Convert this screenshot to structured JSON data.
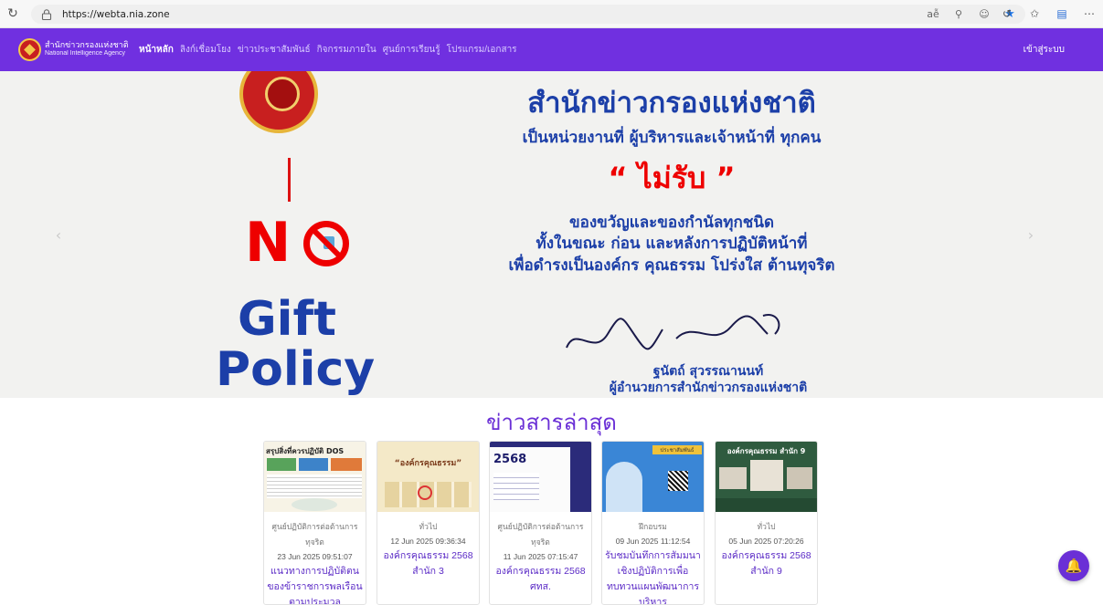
{
  "browser": {
    "url": "https://webta.nia.zone"
  },
  "nav": {
    "brand_th": "สำนักข่าวกรองแห่งชาติ",
    "brand_en": "National Intelligence Agency",
    "items": [
      {
        "label": "หน้าหลัก",
        "active": true
      },
      {
        "label": "ลิงก์เชื่อมโยง",
        "active": false
      },
      {
        "label": "ข่าวประชาสัมพันธ์",
        "active": false
      },
      {
        "label": "กิจกรรมภายใน",
        "active": false
      },
      {
        "label": "ศูนย์การเรียนรู้",
        "active": false
      },
      {
        "label": "โปรแกรม/เอกสาร",
        "active": false
      }
    ],
    "login": "เข้าสู่ระบบ"
  },
  "hero": {
    "no": "N",
    "gift": "Gift",
    "policy": "Policy",
    "title": "สำนักข่าวกรองแห่งชาติ",
    "sub": "เป็นหน่วยงานที่ ผู้บริหารและเจ้าหน้าที่ ทุกคน",
    "quote": "“ ไม่รับ ”",
    "line1": "ของขวัญและของกำนัลทุกชนิด",
    "line2": "ทั้งในขณะ ก่อน และหลังการปฏิบัติหน้าที่",
    "line3": "เพื่อดำรงเป็นองค์กร คุณธรรม โปร่งใส ต้านทุจริต",
    "signer_name": "ฐนัตถ์ สุวรรณานนท์",
    "signer_position": "ผู้อำนวยการสำนักข่าวกรองแห่งชาติ"
  },
  "news": {
    "heading": "ข่าวสารล่าสุด",
    "cards": [
      {
        "category": "ศูนย์ปฏิบัติการต่อต้านการทุจริต",
        "date": "23 Jun 2025 09:51:07",
        "title": "แนวทางการปฏิบัติตนของข้าราชการพลเรือนตามประมวล",
        "thumb_text": "สรุปสิ่งที่ควรปฏิบัติ DOS"
      },
      {
        "category": "ทั่วไป",
        "date": "12 Jun 2025 09:36:34",
        "title": "องค์กรคุณธรรม 2568 สำนัก 3",
        "thumb_text": "“องค์กรคุณธรรม”"
      },
      {
        "category": "ศูนย์ปฏิบัติการต่อต้านการทุจริต",
        "date": "11 Jun 2025 07:15:47",
        "title": "องค์กรคุณธรรม 2568 ศทส.",
        "thumb_text": "2568"
      },
      {
        "category": "ฝึกอบรม",
        "date": "09 Jun 2025 11:12:54",
        "title": "รับชมบันทึกการสัมมนาเชิงปฏิบัติการเพื่อทบทวนแผนพัฒนาการบริหาร",
        "thumb_text": "ประชาสัมพันธ์"
      },
      {
        "category": "ทั่วไป",
        "date": "05 Jun 2025 07:20:26",
        "title": "องค์กรคุณธรรม 2568 สำนัก 9",
        "thumb_text": "องค์กรคุณธรรม สำนัก 9"
      }
    ]
  }
}
